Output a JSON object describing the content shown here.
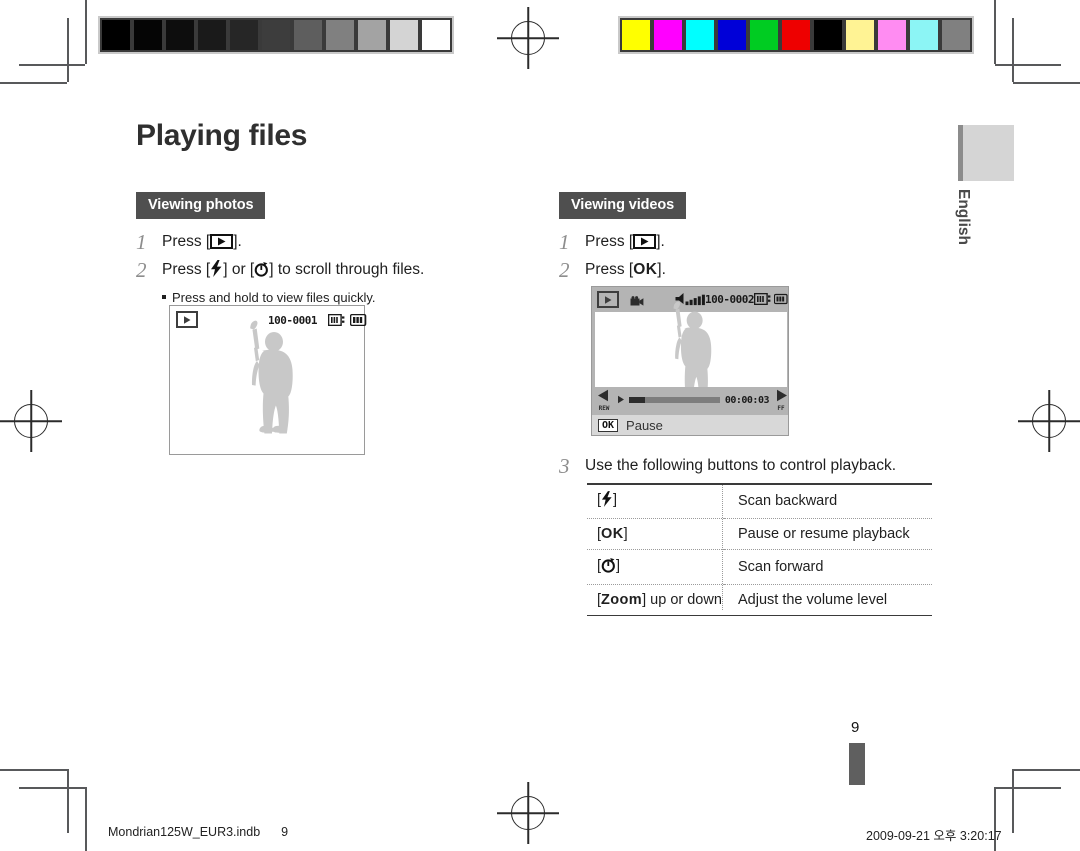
{
  "document": {
    "title": "Playing files",
    "language_tab": "English",
    "page_number": "9"
  },
  "left_column": {
    "section_title": "Viewing photos",
    "steps": [
      {
        "num": "1",
        "pre": "Press [",
        "icon": "play-icon",
        "post": "]."
      },
      {
        "num": "2",
        "pre": "Press [",
        "icon": "flash-icon",
        "mid": "] or [",
        "icon2": "self-timer-icon",
        "post": "] to scroll through files."
      }
    ],
    "bullet": "Press and hold to view files quickly.",
    "lcd": {
      "mode_icon": "play-icon",
      "file_number": "100-0001",
      "memory_icon": "memory-card-icon",
      "battery_icon": "battery-icon"
    }
  },
  "right_column": {
    "section_title": "Viewing videos",
    "steps": [
      {
        "num": "1",
        "pre": "Press [",
        "icon": "play-icon",
        "post": "]."
      },
      {
        "num": "2",
        "pre": "Press [",
        "key": "OK",
        "post": "]."
      },
      {
        "num": "3",
        "text": "Use the following buttons to control playback."
      }
    ],
    "lcd": {
      "mode_icon": "play-icon",
      "movie_icon": "movie-camera-icon",
      "volume_icon": "volume-icon",
      "file_number": "100-0002",
      "memory_icon": "memory-card-icon",
      "battery_icon": "battery-icon",
      "rewind_label": "REW",
      "forward_label": "FF",
      "timecode": "00:00:03",
      "ok_chip": "OK",
      "status_text": "Pause"
    },
    "table": {
      "rows": [
        {
          "key_prefix": "[",
          "key_icon": "flash-icon",
          "key_suffix": "]",
          "key_text": "",
          "desc": "Scan backward"
        },
        {
          "key_prefix": "[",
          "key_icon": "",
          "key_suffix": "]",
          "key_text": "OK",
          "desc": "Pause or resume playback"
        },
        {
          "key_prefix": "[",
          "key_icon": "self-timer-icon",
          "key_suffix": "]",
          "key_text": "",
          "desc": "Scan forward"
        },
        {
          "key_prefix": "[",
          "key_icon": "",
          "key_suffix": "] up or down",
          "key_text": "Zoom",
          "desc": "Adjust the volume level"
        }
      ]
    }
  },
  "footer": {
    "file_name": "Mondrian125W_EUR3.indb",
    "page_ref": "9",
    "timestamp": "2009-09-21   오후 3:20:17"
  },
  "calibration": {
    "gray_patches": [
      "#000000",
      "#050505",
      "#0d0d0d",
      "#1a1a1a",
      "#262626",
      "#3d3d3d",
      "#5e5e5e",
      "#808080",
      "#a3a3a3",
      "#d4d4d4",
      "#ffffff"
    ],
    "color_patches": [
      "#ffff00",
      "#ff00ff",
      "#00ffff",
      "#0000d8",
      "#00cc22",
      "#ee0000",
      "#000000",
      "#fff394",
      "#ff8cf2",
      "#8cf5f5",
      "#808080"
    ]
  }
}
